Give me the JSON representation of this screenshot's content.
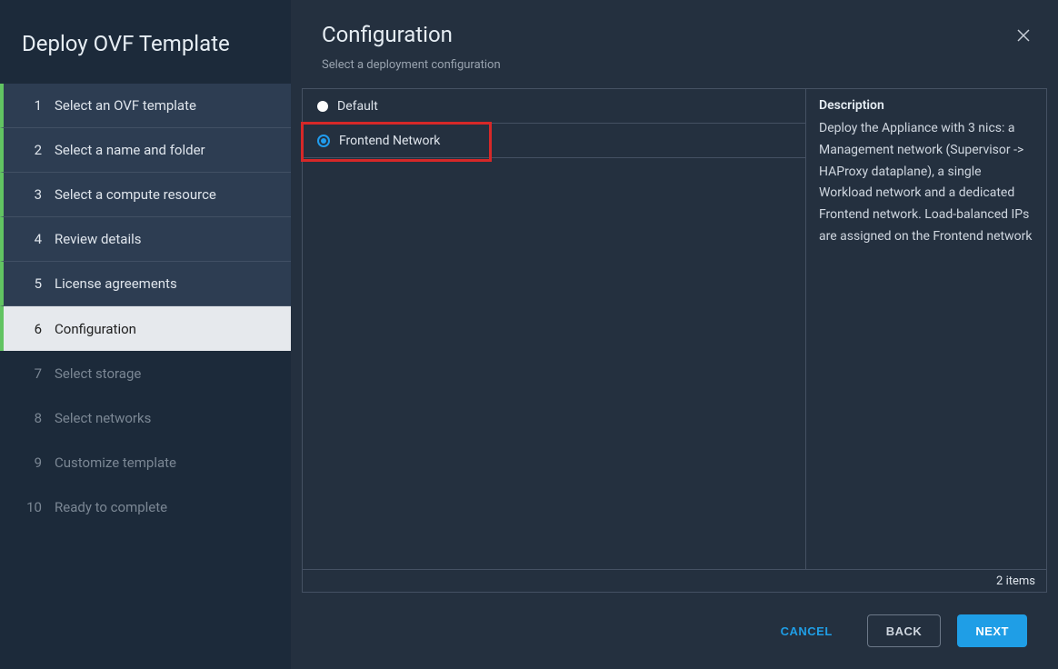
{
  "wizard": {
    "title": "Deploy OVF Template",
    "steps": [
      {
        "num": "1",
        "label": "Select an OVF template",
        "state": "completed"
      },
      {
        "num": "2",
        "label": "Select a name and folder",
        "state": "completed"
      },
      {
        "num": "3",
        "label": "Select a compute resource",
        "state": "completed"
      },
      {
        "num": "4",
        "label": "Review details",
        "state": "completed"
      },
      {
        "num": "5",
        "label": "License agreements",
        "state": "completed"
      },
      {
        "num": "6",
        "label": "Configuration",
        "state": "active"
      },
      {
        "num": "7",
        "label": "Select storage",
        "state": "pending"
      },
      {
        "num": "8",
        "label": "Select networks",
        "state": "pending"
      },
      {
        "num": "9",
        "label": "Customize template",
        "state": "pending"
      },
      {
        "num": "10",
        "label": "Ready to complete",
        "state": "pending"
      }
    ]
  },
  "page": {
    "title": "Configuration",
    "subtitle": "Select a deployment configuration",
    "options": [
      {
        "label": "Default",
        "selected": false
      },
      {
        "label": "Frontend Network",
        "selected": true
      }
    ],
    "items_count": "2 items",
    "description": {
      "title": "Description",
      "text": "Deploy the Appliance with 3 nics: a Management network (Supervisor -> HAProxy dataplane), a single Workload network and a dedicated Frontend network. Load-balanced IPs are assigned on the Frontend network"
    }
  },
  "footer": {
    "cancel": "CANCEL",
    "back": "BACK",
    "next": "NEXT"
  }
}
